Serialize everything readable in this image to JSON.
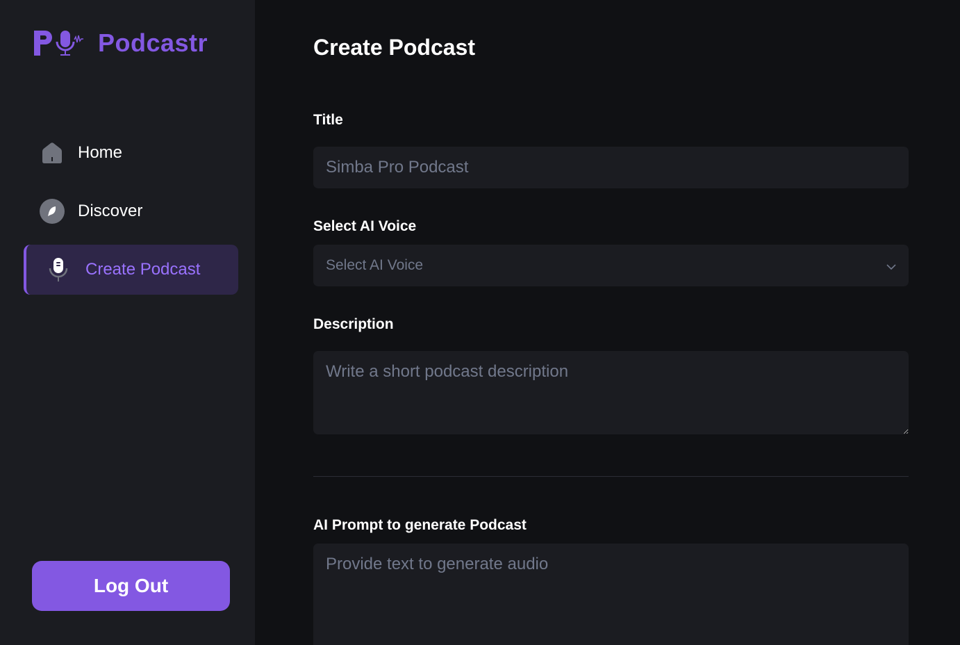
{
  "sidebar": {
    "logo_text": "Podcastr",
    "nav": [
      {
        "label": "Home",
        "icon": "home-icon"
      },
      {
        "label": "Discover",
        "icon": "compass-icon"
      },
      {
        "label": "Create Podcast",
        "icon": "microphone-icon",
        "active": true
      }
    ],
    "logout_label": "Log Out"
  },
  "main": {
    "title": "Create Podcast",
    "title_field": {
      "label": "Title",
      "placeholder": "Simba Pro Podcast"
    },
    "voice_field": {
      "label": "Select AI Voice",
      "placeholder": "Select AI Voice",
      "icon": "chevron-down-icon"
    },
    "description_field": {
      "label": "Description",
      "placeholder": "Write a short podcast description"
    },
    "prompt_field": {
      "label": "AI Prompt to generate Podcast",
      "placeholder": "Provide text to generate audio"
    }
  },
  "colors": {
    "accent": "#8358e2",
    "background": "#101114",
    "sidebar": "#1b1c21",
    "input": "#1b1c21",
    "placeholder": "#71788b"
  }
}
